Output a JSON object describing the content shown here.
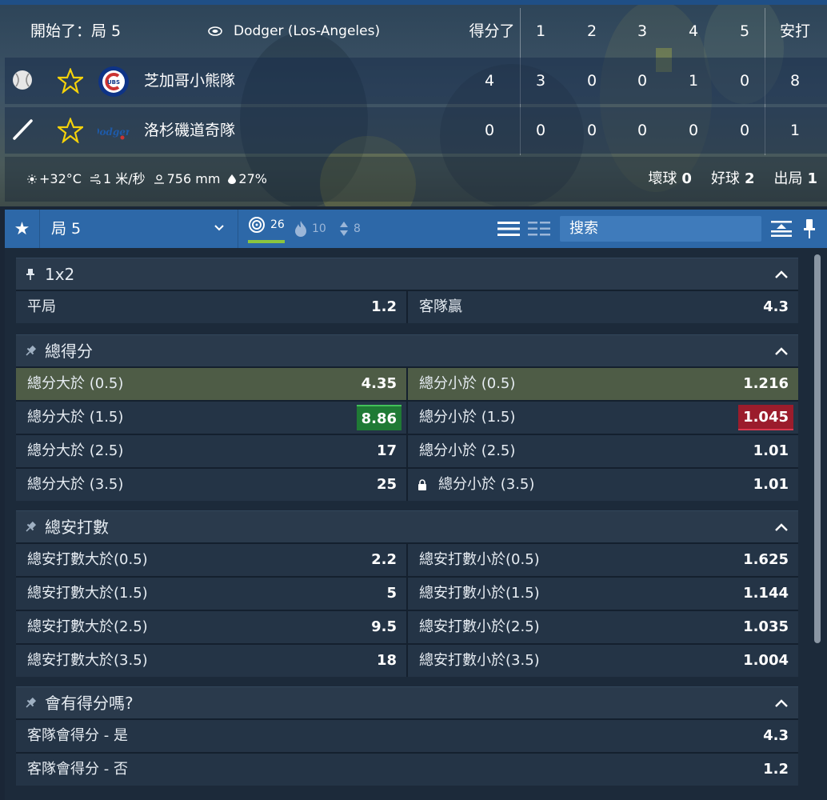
{
  "scoreboard": {
    "status": "開始了：局 5",
    "stadium": "Dodger (Los-Angeles)",
    "headers": [
      "得分了",
      "1",
      "2",
      "3",
      "4",
      "5",
      "安打"
    ],
    "teams": [
      {
        "name": "芝加哥小熊隊",
        "scores": [
          "4",
          "3",
          "0",
          "0",
          "1",
          "0",
          "8"
        ],
        "logo": "cubs-logo",
        "role_icon": "baseball-icon"
      },
      {
        "name": "洛杉磯道奇隊",
        "scores": [
          "0",
          "0",
          "0",
          "0",
          "0",
          "0",
          "1"
        ],
        "logo": "dodgers-logo",
        "role_icon": "bat-icon"
      }
    ],
    "weather": {
      "temperature": "+32°C",
      "wind": "1 米/秒",
      "pressure": "756 mm",
      "humidity": "27%"
    },
    "count": {
      "balls_label": "壞球",
      "balls": "0",
      "strikes_label": "好球",
      "strikes": "2",
      "outs_label": "出局",
      "outs": "1"
    }
  },
  "toolbar": {
    "period": "局 5",
    "filters": [
      {
        "icon": "target-icon",
        "count": "26"
      },
      {
        "icon": "fire-icon",
        "count": "10"
      },
      {
        "icon": "sort-arrows-icon",
        "count": "8"
      }
    ],
    "search_placeholder": "搜索"
  },
  "markets": [
    {
      "title": "1x2",
      "rows": [
        {
          "name": "平局",
          "odd": "1.2"
        },
        {
          "name": "客隊贏",
          "odd": "4.3"
        }
      ]
    },
    {
      "title": "總得分",
      "rows": [
        {
          "name": "總分大於 (0.5)",
          "odd": "4.35",
          "highlight": true
        },
        {
          "name": "總分小於 (0.5)",
          "odd": "1.216",
          "highlight": true
        },
        {
          "name": "總分大於 (1.5)",
          "odd": "8.86",
          "change": "up"
        },
        {
          "name": "總分小於 (1.5)",
          "odd": "1.045",
          "change": "down"
        },
        {
          "name": "總分大於 (2.5)",
          "odd": "17"
        },
        {
          "name": "總分小於 (2.5)",
          "odd": "1.01"
        },
        {
          "name": "總分大於 (3.5)",
          "odd": "25"
        },
        {
          "name": "總分小於 (3.5)",
          "odd": "1.01",
          "locked": true
        }
      ]
    },
    {
      "title": "總安打數",
      "rows": [
        {
          "name": "總安打數大於(0.5)",
          "odd": "2.2"
        },
        {
          "name": "總安打數小於(0.5)",
          "odd": "1.625"
        },
        {
          "name": "總安打數大於(1.5)",
          "odd": "5"
        },
        {
          "name": "總安打數小於(1.5)",
          "odd": "1.144"
        },
        {
          "name": "總安打數大於(2.5)",
          "odd": "9.5"
        },
        {
          "name": "總安打數小於(2.5)",
          "odd": "1.035"
        },
        {
          "name": "總安打數大於(3.5)",
          "odd": "18"
        },
        {
          "name": "總安打數小於(3.5)",
          "odd": "1.004"
        }
      ]
    },
    {
      "title": "會有得分嗎?",
      "rows": [
        {
          "name": "客隊會得分 - 是",
          "odd": "4.3"
        },
        {
          "name": "客隊會得分 - 否",
          "odd": "1.2"
        }
      ]
    }
  ],
  "colors": {
    "toolbar": "#2d68a8",
    "highlight": "#4e5c46",
    "odd_up": "#1f7a35",
    "odd_down": "#9b1c2c",
    "star": "#f5d20a",
    "active_filter": "#8cc63f"
  }
}
